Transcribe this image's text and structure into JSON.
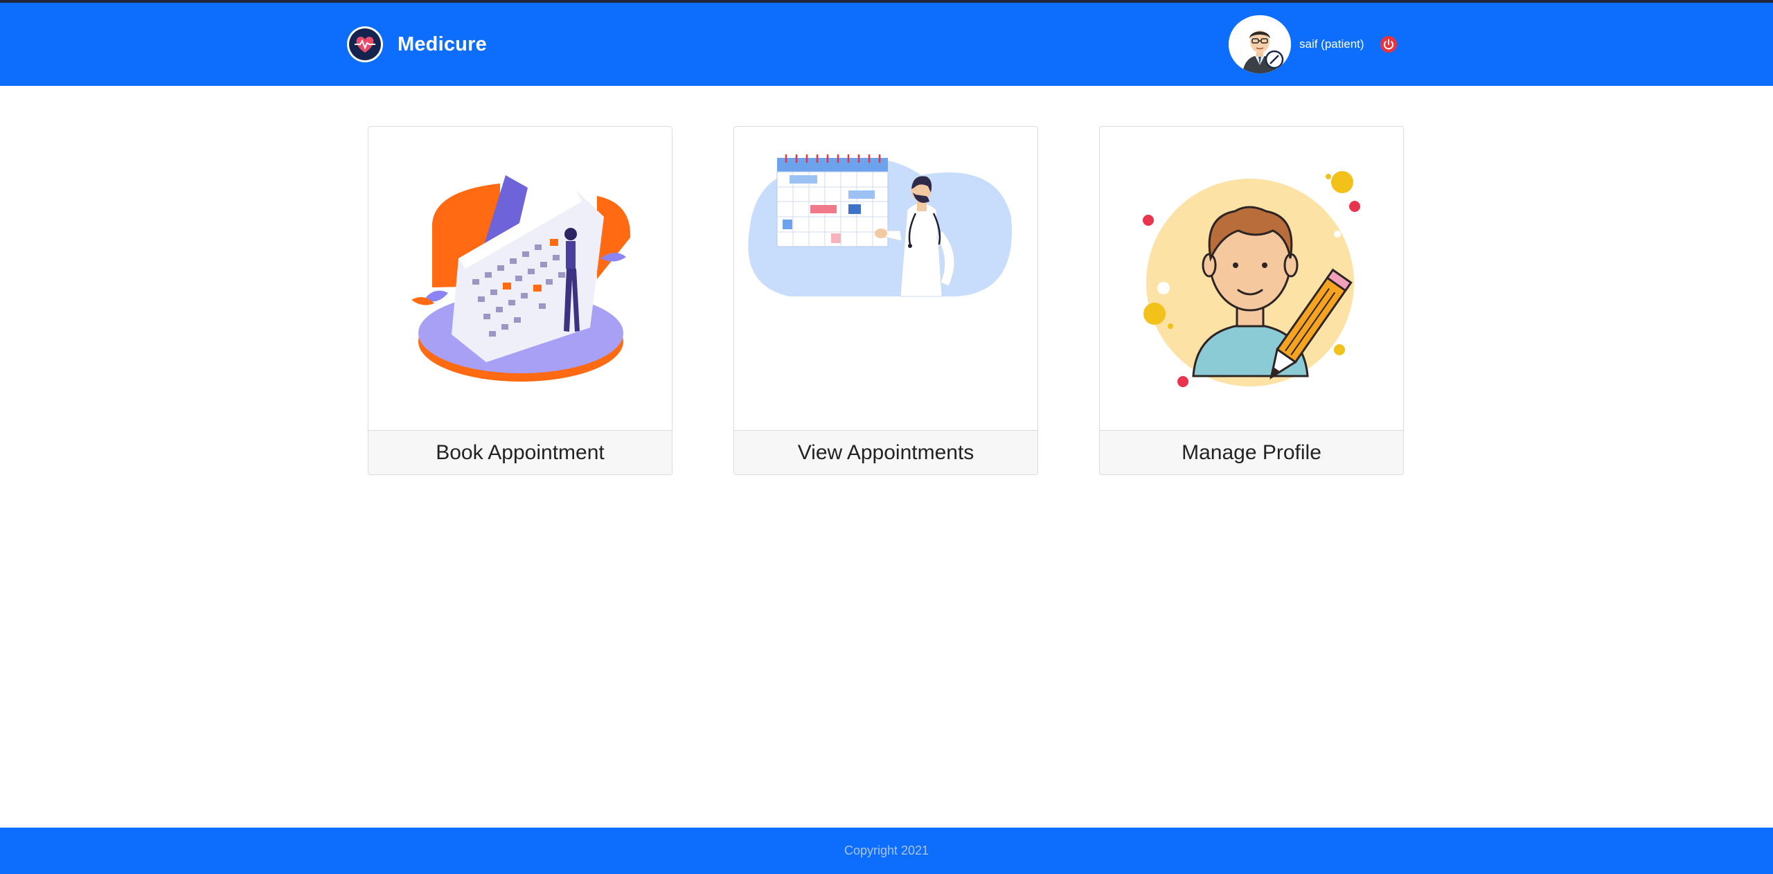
{
  "header": {
    "brand_name": "Medicure",
    "logo_icon": "heartbeat-logo-icon",
    "user_label": "saif (patient)",
    "avatar_icon": "doctor-avatar-icon",
    "logout_icon": "power-icon"
  },
  "cards": [
    {
      "label": "Book Appointment",
      "image_icon": "calendar-illustration"
    },
    {
      "label": "View Appointments",
      "image_icon": "doctor-calendar-illustration"
    },
    {
      "label": "Manage Profile",
      "image_icon": "profile-edit-illustration"
    }
  ],
  "footer": {
    "copyright": "Copyright 2021"
  },
  "colors": {
    "primary": "#0d6efd",
    "logout": "#e8343e",
    "accent_orange": "#ff6a13",
    "accent_purple": "#8c83f4"
  }
}
